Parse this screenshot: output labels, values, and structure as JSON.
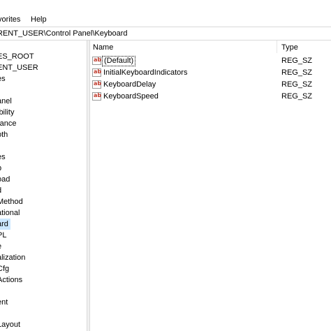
{
  "menu": {
    "favorites": "vorites",
    "help": "Help"
  },
  "address": {
    "path": "RENT_USER\\Control Panel\\Keyboard"
  },
  "tree": {
    "items": [
      "ES_ROOT",
      "ENT_USER",
      "es",
      "",
      "anel",
      "ibility",
      "rance",
      "oth",
      "",
      "es",
      "p",
      "oad",
      "d",
      "Method",
      "ational",
      "ard",
      "PL",
      "e",
      "alization",
      "Cfg",
      "Actions",
      "",
      "ent",
      "",
      " Layout"
    ],
    "selected_index": 15
  },
  "list": {
    "columns": {
      "name": "Name",
      "type": "Type"
    },
    "rows": [
      {
        "icon": "ab",
        "name": "(Default)",
        "type": "REG_SZ"
      },
      {
        "icon": "ab",
        "name": "InitialKeyboardIndicators",
        "type": "REG_SZ"
      },
      {
        "icon": "ab",
        "name": "KeyboardDelay",
        "type": "REG_SZ"
      },
      {
        "icon": "ab",
        "name": "KeyboardSpeed",
        "type": "REG_SZ"
      }
    ]
  },
  "colors": {
    "selection": "#cce8ff",
    "icon_text": "#c0392b"
  }
}
